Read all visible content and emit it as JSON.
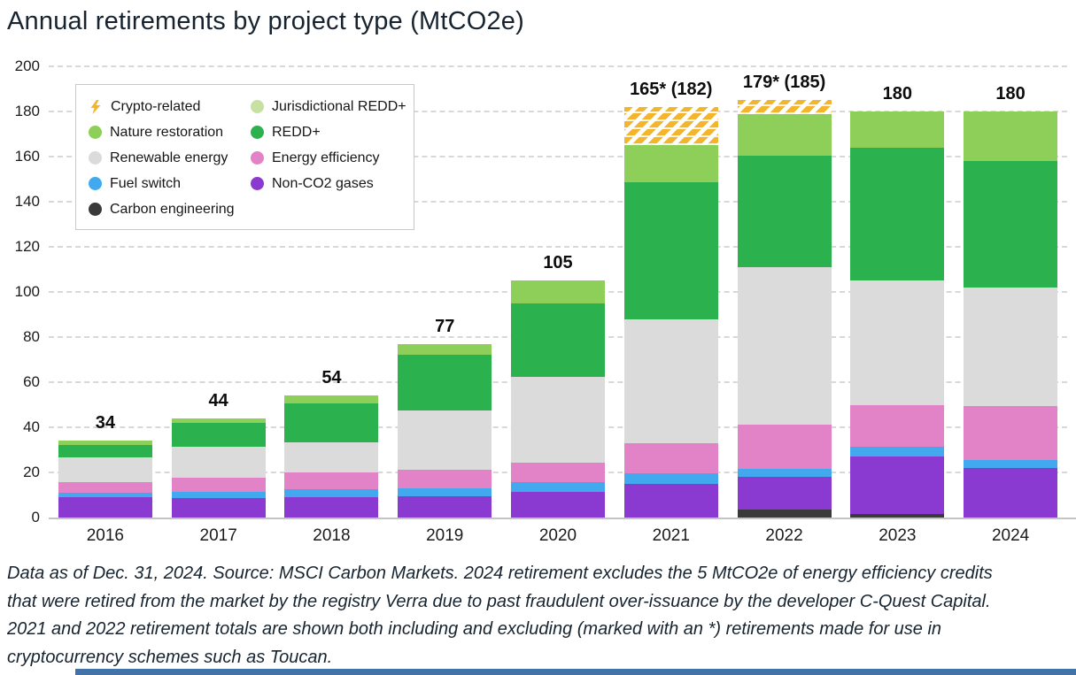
{
  "title": "Annual retirements by project type (MtCO2e)",
  "legend": {
    "columns": [
      [
        {
          "key": "crypto-related",
          "label": "Crypto-related",
          "color": "#F2B52B",
          "swatch": "bolt"
        },
        {
          "key": "nature-restoration",
          "label": "Nature restoration",
          "color": "#8DCF58",
          "swatch": "circle"
        },
        {
          "key": "renewable-energy",
          "label": "Renewable energy",
          "color": "#DBDBDB",
          "swatch": "circle"
        },
        {
          "key": "fuel-switch",
          "label": "Fuel switch",
          "color": "#42A9EF",
          "swatch": "circle"
        },
        {
          "key": "carbon-engineering",
          "label": "Carbon engineering",
          "color": "#3A3A3A",
          "swatch": "circle"
        }
      ],
      [
        {
          "key": "jurisdictional-redd",
          "label": "Jurisdictional REDD+",
          "color": "#C6E1A2",
          "swatch": "circle"
        },
        {
          "key": "redd",
          "label": "REDD+",
          "color": "#2BB14E",
          "swatch": "circle"
        },
        {
          "key": "energy-efficiency",
          "label": "Energy efficiency",
          "color": "#E283C8",
          "swatch": "circle"
        },
        {
          "key": "non-co2-gases",
          "label": "Non-CO2 gases",
          "color": "#8A3AD1",
          "swatch": "circle"
        }
      ]
    ]
  },
  "chart_data": {
    "type": "bar",
    "stacked": true,
    "title": "Annual retirements by project type (MtCO2e)",
    "categories": [
      "2016",
      "2017",
      "2018",
      "2019",
      "2020",
      "2021",
      "2022",
      "2023",
      "2024"
    ],
    "series": [
      {
        "key": "carbon-engineering",
        "name": "Carbon engineering",
        "color": "#3A3A3A",
        "values": [
          0,
          0,
          0,
          0,
          0,
          0,
          3.5,
          1.5,
          0
        ]
      },
      {
        "key": "non-co2-gases",
        "name": "Non-CO2 gases",
        "color": "#8A3AD1",
        "values": [
          9,
          8.5,
          9,
          9.5,
          11.5,
          15,
          14.5,
          25.5,
          22
        ]
      },
      {
        "key": "fuel-switch",
        "name": "Fuel switch",
        "color": "#42A9EF",
        "values": [
          2,
          3,
          3.5,
          3.5,
          4,
          4.5,
          3.5,
          4.5,
          3.5
        ]
      },
      {
        "key": "energy-efficiency",
        "name": "Energy efficiency",
        "color": "#E283C8",
        "values": [
          4.5,
          6,
          7.5,
          8,
          9,
          13.5,
          19.5,
          18.5,
          24
        ]
      },
      {
        "key": "renewable-energy",
        "name": "Renewable energy",
        "color": "#DBDBDB",
        "values": [
          11,
          14,
          13.5,
          26.5,
          38,
          55,
          70,
          55,
          52.5
        ]
      },
      {
        "key": "redd",
        "name": "REDD+",
        "color": "#2BB14E",
        "values": [
          5.5,
          10.5,
          17,
          24.5,
          32.5,
          60.5,
          49.5,
          59,
          56
        ]
      },
      {
        "key": "jurisdictional-redd",
        "name": "Jurisdictional REDD+",
        "color": "#C6E1A2",
        "values": [
          0,
          0,
          0,
          0,
          0,
          0,
          0,
          0,
          0
        ]
      },
      {
        "key": "nature-restoration",
        "name": "Nature restoration",
        "color": "#8DCF58",
        "values": [
          2,
          2,
          3.5,
          5,
          10,
          16.5,
          18.5,
          16,
          22
        ]
      },
      {
        "key": "crypto-related",
        "name": "Crypto-related",
        "color": "#F2B52B",
        "hatch": true,
        "values": [
          0,
          0,
          0,
          0,
          0,
          17,
          6,
          0,
          0
        ]
      }
    ],
    "totals_excluding_crypto": [
      34,
      44,
      54,
      77,
      105,
      165,
      179,
      180,
      180
    ],
    "totals_including_crypto": [
      34,
      44,
      54,
      77,
      105,
      182,
      185,
      180,
      180
    ],
    "bar_totals": [
      "34",
      "44",
      "54",
      "77",
      "105",
      "165* (182)",
      "179* (185)",
      "180",
      "180"
    ],
    "ylabel": "",
    "xlabel": "",
    "ylim": [
      0,
      200
    ],
    "yticks": [
      0,
      20,
      40,
      60,
      80,
      100,
      120,
      140,
      160,
      180,
      200
    ],
    "grid": "dashed horizontal",
    "legend_position": "top-left inside plot"
  },
  "footer": {
    "lines": [
      "Data as of Dec. 31, 2024. Source: MSCI Carbon Markets. 2024 retirement excludes the 5 MtCO2e of energy efficiency credits",
      "that were retired from the market by the registry Verra due to past fraudulent over-issuance by the developer C-Quest Capital.",
      "2021 and 2022 retirement totals are shown both including and excluding (marked with an *) retirements made for use in",
      "cryptocurrency schemes such as Toucan."
    ]
  },
  "colors": {
    "title_text": "#172430",
    "grid": "#D8D8D8",
    "axis": "#C4C4C4",
    "accent_bar": "#4273A8",
    "crypto_hatch": "#F2B52B"
  }
}
